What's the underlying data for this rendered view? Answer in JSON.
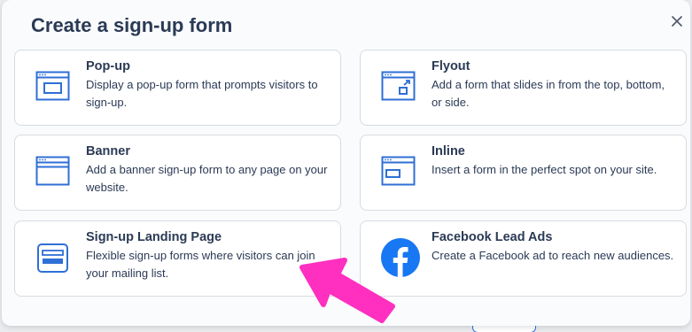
{
  "modal": {
    "title": "Create a sign-up form",
    "close_icon": "close-icon"
  },
  "options": [
    {
      "id": "popup",
      "name": "Pop-up",
      "description": "Display a pop-up form that prompts visitors to sign-up.",
      "icon": "popup-window-icon"
    },
    {
      "id": "flyout",
      "name": "Flyout",
      "description": "Add a form that slides in from the top, bottom, or side.",
      "icon": "flyout-window-icon"
    },
    {
      "id": "banner",
      "name": "Banner",
      "description": "Add a banner sign-up form to any page on your website.",
      "icon": "banner-window-icon"
    },
    {
      "id": "inline",
      "name": "Inline",
      "description": "Insert a form in the perfect spot on your site.",
      "icon": "inline-window-icon"
    },
    {
      "id": "landing",
      "name": "Sign-up Landing Page",
      "description": "Flexible sign-up forms where visitors can join your mailing list.",
      "icon": "landing-page-icon"
    },
    {
      "id": "facebook",
      "name": "Facebook Lead Ads",
      "description": "Create a Facebook ad to reach new audiences.",
      "icon": "facebook-icon"
    }
  ],
  "colors": {
    "accent": "#2f6fd6",
    "text": "#2b3a55",
    "facebook": "#1877f2",
    "annotation_arrow": "#ff2fc0"
  }
}
